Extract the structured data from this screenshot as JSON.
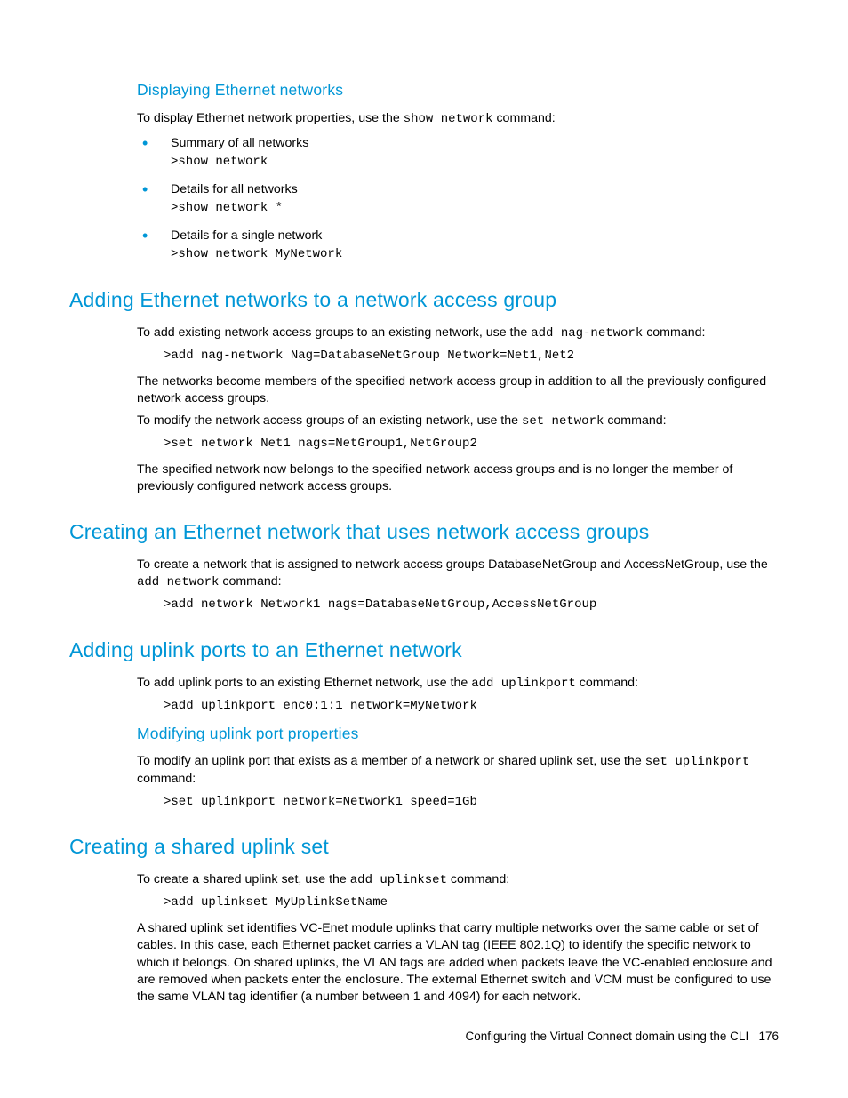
{
  "sec_display": {
    "heading": "Displaying Ethernet networks",
    "intro_pre": "To display Ethernet network properties, use the ",
    "intro_code": "show network",
    "intro_post": " command:",
    "items": [
      {
        "text": "Summary of all networks",
        "cmd": ">show network"
      },
      {
        "text": "Details for all networks",
        "cmd": ">show network *"
      },
      {
        "text": "Details for a single network",
        "cmd": ">show network MyNetwork"
      }
    ]
  },
  "sec_add_nag": {
    "heading": "Adding Ethernet networks to a network access group",
    "p1_pre": "To add existing network access groups to an existing network, use the ",
    "p1_code": "add nag-network",
    "p1_post": " command:",
    "cmd1": ">add nag-network Nag=DatabaseNetGroup Network=Net1,Net2",
    "p2": "The networks become members of the specified network access group in addition to all the previously configured network access groups.",
    "p3_pre": "To modify the network access groups of an existing network, use the ",
    "p3_code": "set network",
    "p3_post": " command:",
    "cmd2": ">set network Net1 nags=NetGroup1,NetGroup2",
    "p4": "The specified network now belongs to the specified network access groups and is no longer the member of previously configured network access groups."
  },
  "sec_create_nag": {
    "heading": "Creating an Ethernet network that uses network access groups",
    "p1_pre": "To create a network that is assigned to network access groups DatabaseNetGroup and AccessNetGroup, use the ",
    "p1_code": "add network",
    "p1_post": " command:",
    "cmd1": ">add network Network1 nags=DatabaseNetGroup,AccessNetGroup"
  },
  "sec_uplink": {
    "heading": "Adding uplink ports to an Ethernet network",
    "p1_pre": "To add uplink ports to an existing Ethernet network, use the ",
    "p1_code": "add uplinkport",
    "p1_post": " command:",
    "cmd1": ">add uplinkport enc0:1:1 network=MyNetwork"
  },
  "sec_modify_uplink": {
    "heading": "Modifying uplink port properties",
    "p1_pre": "To modify an uplink port that exists as a member of a network or shared uplink set, use the ",
    "p1_code": "set uplinkport",
    "p1_post": " command:",
    "cmd1": ">set uplinkport network=Network1 speed=1Gb"
  },
  "sec_shared": {
    "heading": "Creating a shared uplink set",
    "p1_pre": "To create a shared uplink set, use the ",
    "p1_code": "add uplinkset",
    "p1_post": " command:",
    "cmd1": ">add uplinkset MyUplinkSetName",
    "p2": "A shared uplink set identifies VC-Enet module uplinks that carry multiple networks over the same cable or set of cables. In this case, each Ethernet packet carries a VLAN tag (IEEE 802.1Q) to identify the specific network to which it belongs. On shared uplinks, the VLAN tags are added when packets leave the VC-enabled enclosure and are removed when packets enter the enclosure. The external Ethernet switch and VCM must be configured to use the same VLAN tag identifier (a number between 1 and 4094) for each network."
  },
  "footer": {
    "text": "Configuring the Virtual Connect domain using the CLI",
    "page": "176"
  }
}
